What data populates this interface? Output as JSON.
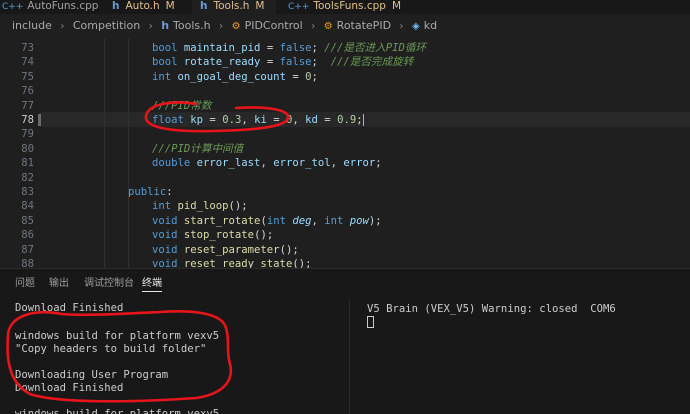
{
  "tabs": [
    {
      "name": "AutoFuns.cpp",
      "icon": "cpp-file-icon",
      "modified": ""
    },
    {
      "name": "Auto.h",
      "icon": "h-file-icon",
      "modified": "M"
    },
    {
      "name": "Tools.h",
      "icon": "h-file-icon",
      "modified": "M",
      "active": true
    },
    {
      "name": "ToolsFuns.cpp",
      "icon": "cpp-file-icon",
      "modified": "M"
    }
  ],
  "breadcrumb": {
    "items": [
      "include",
      "Competition",
      "Tools.h",
      "PIDControl",
      "RotatePID",
      "kd"
    ]
  },
  "editor": {
    "current_line": "78",
    "lines": [
      {
        "n": "73",
        "parts": [
          [
            "kw",
            "bool "
          ],
          [
            "var",
            "maintain_pid"
          ],
          [
            "op",
            " = "
          ],
          [
            "kw",
            "false"
          ],
          [
            "op",
            "; "
          ],
          [
            "cm",
            "///是否进入PID循环"
          ]
        ]
      },
      {
        "n": "74",
        "parts": [
          [
            "kw",
            "bool "
          ],
          [
            "var",
            "rotate_ready"
          ],
          [
            "op",
            " = "
          ],
          [
            "kw",
            "false"
          ],
          [
            "op",
            ";  "
          ],
          [
            "cm",
            "///是否完成旋转"
          ]
        ]
      },
      {
        "n": "75",
        "parts": [
          [
            "kw",
            "int "
          ],
          [
            "var",
            "on_goal_deg_count"
          ],
          [
            "op",
            " = "
          ],
          [
            "num",
            "0"
          ],
          [
            "op",
            ";"
          ]
        ]
      },
      {
        "n": "76",
        "parts": []
      },
      {
        "n": "77",
        "parts": [
          [
            "cm",
            "///PID常数"
          ]
        ]
      },
      {
        "n": "78",
        "parts": [
          [
            "kw",
            "float "
          ],
          [
            "var",
            "kp"
          ],
          [
            "op",
            " = "
          ],
          [
            "num",
            "0.3"
          ],
          [
            "op",
            ", "
          ],
          [
            "var",
            "ki"
          ],
          [
            "op",
            " = "
          ],
          [
            "num",
            "0"
          ],
          [
            "op",
            ", "
          ],
          [
            "var",
            "kd"
          ],
          [
            "op",
            " = "
          ],
          [
            "num",
            "0.9"
          ],
          [
            "op",
            ";"
          ]
        ]
      },
      {
        "n": "79",
        "parts": []
      },
      {
        "n": "80",
        "parts": [
          [
            "cm",
            "///PID计算中间值"
          ]
        ]
      },
      {
        "n": "81",
        "parts": [
          [
            "kw",
            "double "
          ],
          [
            "var",
            "error_last"
          ],
          [
            "op",
            ", "
          ],
          [
            "var",
            "error_tol"
          ],
          [
            "op",
            ", "
          ],
          [
            "var",
            "error"
          ],
          [
            "op",
            ";"
          ]
        ]
      },
      {
        "n": "82",
        "parts": []
      },
      {
        "n": "83",
        "parts": [
          [
            "lbl",
            "public"
          ],
          [
            "op",
            ":"
          ]
        ],
        "outdent": true
      },
      {
        "n": "84",
        "parts": [
          [
            "kw",
            "int "
          ],
          [
            "fn",
            "pid_loop"
          ],
          [
            "op",
            "();"
          ]
        ]
      },
      {
        "n": "85",
        "parts": [
          [
            "kw",
            "void "
          ],
          [
            "fn",
            "start_rotate"
          ],
          [
            "op",
            "("
          ],
          [
            "kw",
            "int "
          ],
          [
            "param",
            "deg"
          ],
          [
            "op",
            ", "
          ],
          [
            "kw",
            "int "
          ],
          [
            "param",
            "pow"
          ],
          [
            "op",
            ");"
          ]
        ]
      },
      {
        "n": "86",
        "parts": [
          [
            "kw",
            "void "
          ],
          [
            "fn",
            "stop_rotate"
          ],
          [
            "op",
            "();"
          ]
        ]
      },
      {
        "n": "87",
        "parts": [
          [
            "kw",
            "void "
          ],
          [
            "fn",
            "reset_parameter"
          ],
          [
            "op",
            "();"
          ]
        ]
      },
      {
        "n": "88",
        "parts": [
          [
            "kw",
            "void "
          ],
          [
            "fn",
            "reset_ready_state"
          ],
          [
            "op",
            "();"
          ]
        ]
      }
    ]
  },
  "panel": {
    "tabs": [
      "问题",
      "输出",
      "调试控制台",
      "终端"
    ],
    "active_tab": "终端",
    "terminal_left": [
      "Download Finished",
      "",
      "windows build for platform vexv5",
      "\"Copy headers to build folder\"",
      "",
      "Downloading User Program",
      "Download Finished",
      "",
      "windows build for platform vexv5"
    ],
    "terminal_right": "V5 Brain (VEX_V5) Warning: closed  COM6"
  },
  "colors": {
    "annotation": "#e8141c",
    "modified": "#e2c08d",
    "keyword": "#569cd6",
    "comment": "#6a9955"
  }
}
